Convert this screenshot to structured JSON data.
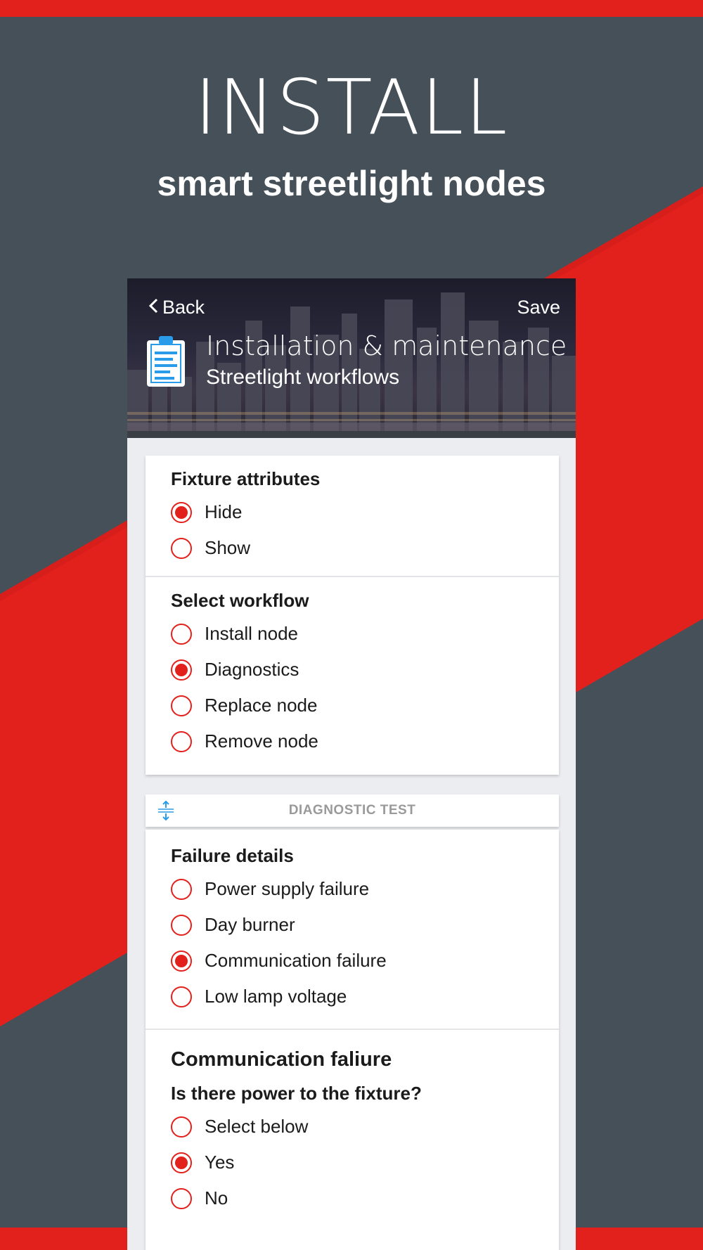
{
  "hero": {
    "title": "INSTALL",
    "subtitle": "smart streetlight nodes"
  },
  "colors": {
    "accent": "#e2211d",
    "background": "#465058",
    "icon_blue": "#2a9be8"
  },
  "app": {
    "header": {
      "back_label": "Back",
      "save_label": "Save",
      "title": "Installation & maintenance",
      "subtitle": "Streetlight workflows",
      "icon": "clipboard-icon"
    },
    "fixture_attributes": {
      "title": "Fixture attributes",
      "options": [
        {
          "label": "Hide",
          "selected": true
        },
        {
          "label": "Show",
          "selected": false
        }
      ]
    },
    "select_workflow": {
      "title": "Select workflow",
      "options": [
        {
          "label": "Install node",
          "selected": false
        },
        {
          "label": "Diagnostics",
          "selected": true
        },
        {
          "label": "Replace node",
          "selected": false
        },
        {
          "label": "Remove node",
          "selected": false
        }
      ]
    },
    "diagnostic_bar": {
      "label": "DIAGNOSTIC TEST",
      "icon": "resize-vertical-icon"
    },
    "failure_details": {
      "title": "Failure details",
      "options": [
        {
          "label": "Power supply failure",
          "selected": false
        },
        {
          "label": "Day burner",
          "selected": false
        },
        {
          "label": "Communication failure",
          "selected": true
        },
        {
          "label": "Low lamp voltage",
          "selected": false
        }
      ]
    },
    "communication_failure": {
      "title": "Communication faliure",
      "question": "Is there power to the fixture?",
      "options": [
        {
          "label": "Select below",
          "selected": false
        },
        {
          "label": "Yes",
          "selected": true
        },
        {
          "label": "No",
          "selected": false
        }
      ]
    }
  }
}
